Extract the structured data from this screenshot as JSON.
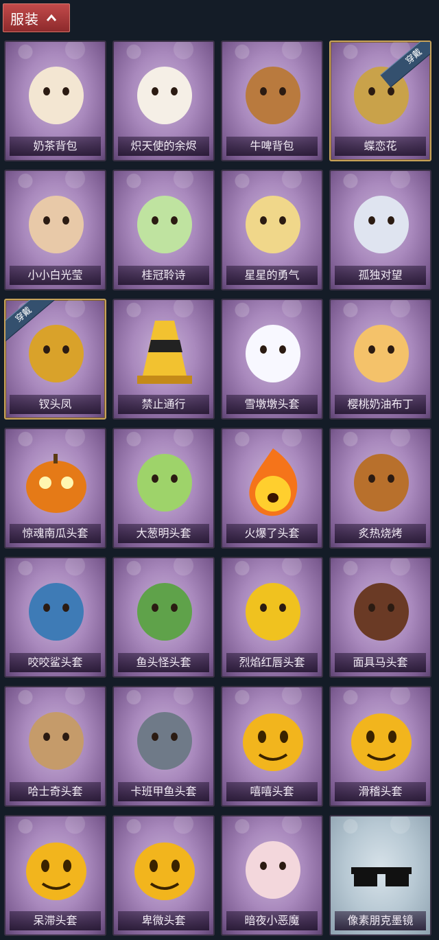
{
  "header": {
    "title": "服装"
  },
  "equipped_label": "穿戴",
  "items": [
    {
      "name": "奶茶背包",
      "icon": "milk-tea-backpack"
    },
    {
      "name": "炽天使的余烬",
      "icon": "angel-doll"
    },
    {
      "name": "牛啤背包",
      "icon": "cow-beer-backpack"
    },
    {
      "name": "蝶恋花",
      "icon": "butterfly-flower",
      "equipped": true
    },
    {
      "name": "小小白光莹",
      "icon": "doll-charm"
    },
    {
      "name": "桂冠聆诗",
      "icon": "laurel-doll-charm"
    },
    {
      "name": "星星的勇气",
      "icon": "star-doll-charm"
    },
    {
      "name": "孤独对望",
      "icon": "silver-doll-charm"
    },
    {
      "name": "钗头凤",
      "icon": "phoenix-crown",
      "equipped": true
    },
    {
      "name": "禁止通行",
      "icon": "traffic-cone-hat"
    },
    {
      "name": "雪墩墩头套",
      "icon": "snowman-head"
    },
    {
      "name": "樱桃奶油布丁",
      "icon": "pudding-head"
    },
    {
      "name": "惊魂南瓜头套",
      "icon": "pumpkin-head"
    },
    {
      "name": "大葱明头套",
      "icon": "scallion-head"
    },
    {
      "name": "火爆了头套",
      "icon": "fire-head"
    },
    {
      "name": "炙热烧烤",
      "icon": "bbq-meat-head"
    },
    {
      "name": "咬咬鲨头套",
      "icon": "shark-head"
    },
    {
      "name": "鱼头怪头套",
      "icon": "fish-head"
    },
    {
      "name": "烈焰红唇头套",
      "icon": "pika-head"
    },
    {
      "name": "面具马头套",
      "icon": "horse-head"
    },
    {
      "name": "哈士奇头套",
      "icon": "husky-head"
    },
    {
      "name": "卡班甲鱼头套",
      "icon": "cabanfish-head"
    },
    {
      "name": "嘻嘻头套",
      "icon": "grin-emoji-head"
    },
    {
      "name": "滑稽头套",
      "icon": "funny-emoji-head"
    },
    {
      "name": "呆滞头套",
      "icon": "dazed-emoji-head"
    },
    {
      "name": "卑微头套",
      "icon": "humble-emoji-head"
    },
    {
      "name": "暗夜小恶魔",
      "icon": "little-devil-head"
    },
    {
      "name": "像素朋克墨镜",
      "icon": "pixel-sunglasses",
      "silver": true
    }
  ],
  "colors": {
    "background": "#141c27",
    "card_purple": "#a989bd",
    "header_red": "#c24a4a",
    "equipped_gold": "#c8a35a"
  }
}
